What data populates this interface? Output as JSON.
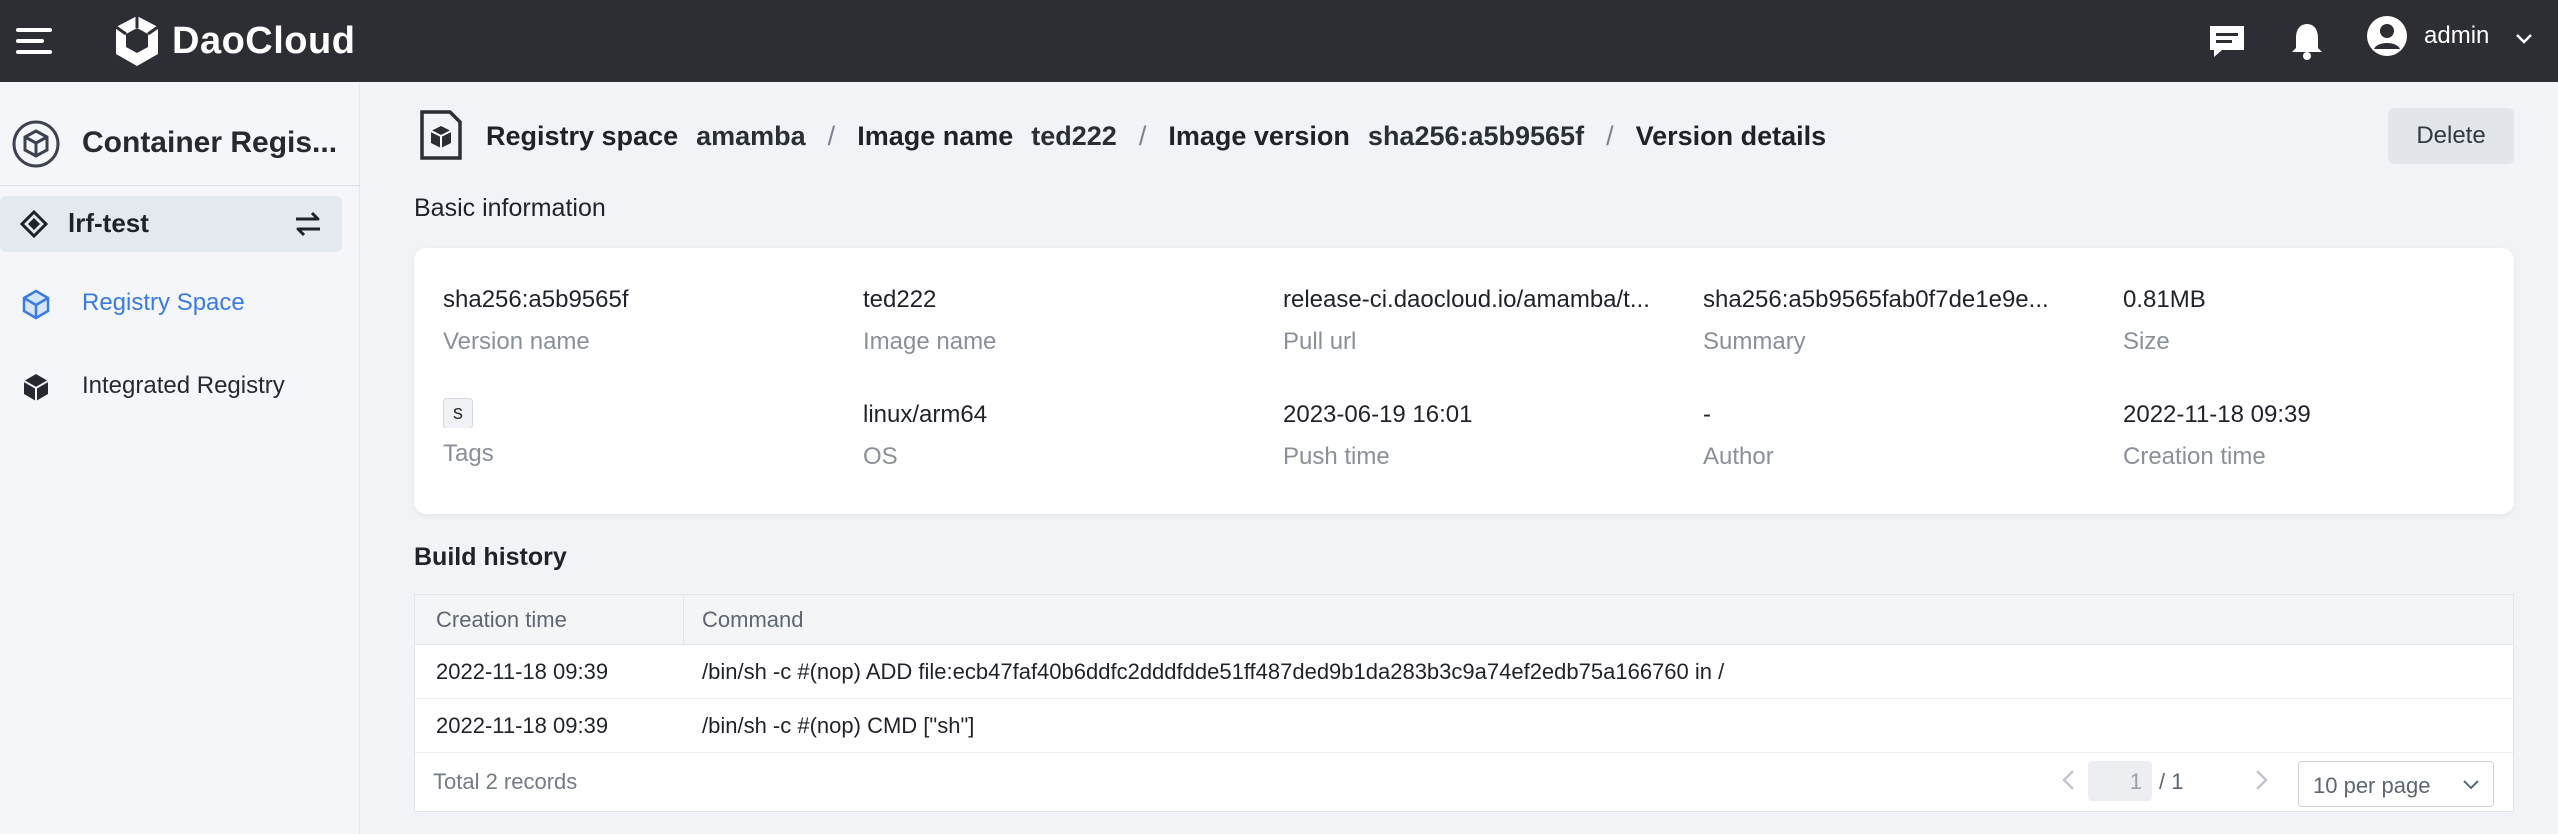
{
  "header": {
    "brand": "DaoCloud",
    "username": "admin"
  },
  "sidebar": {
    "title": "Container Regis...",
    "workspace": "lrf-test",
    "items": [
      {
        "label": "Registry Space",
        "active": true
      },
      {
        "label": "Integrated Registry",
        "active": false
      }
    ]
  },
  "breadcrumb": {
    "space_key": "Registry space",
    "space_value": "amamba",
    "image_key": "Image name",
    "image_value": "ted222",
    "version_key": "Image version",
    "version_value": "sha256:a5b9565f",
    "current": "Version details",
    "separator": "/"
  },
  "actions": {
    "delete_label": "Delete"
  },
  "basic_info": {
    "title": "Basic information",
    "version_name": {
      "value": "sha256:a5b9565f",
      "label": "Version name"
    },
    "image_name": {
      "value": "ted222",
      "label": "Image name"
    },
    "pull_url": {
      "value": "release-ci.daocloud.io/amamba/t...",
      "label": "Pull url"
    },
    "summary": {
      "value": "sha256:a5b9565fab0f7de1e9e...",
      "label": "Summary"
    },
    "size": {
      "value": "0.81MB",
      "label": "Size"
    },
    "tags": {
      "value": "s",
      "label": "Tags"
    },
    "os": {
      "value": "linux/arm64",
      "label": "OS"
    },
    "push_time": {
      "value": "2023-06-19 16:01",
      "label": "Push time"
    },
    "author": {
      "value": "-",
      "label": "Author"
    },
    "creation_time": {
      "value": "2022-11-18 09:39",
      "label": "Creation time"
    }
  },
  "build_history": {
    "title": "Build history",
    "columns": [
      "Creation time",
      "Command"
    ],
    "rows": [
      {
        "time": "2022-11-18 09:39",
        "command": "/bin/sh -c #(nop) ADD file:ecb47faf40b6ddfc2dddfdde51ff487ded9b1da283b3c9a74ef2edb75a166760 in /"
      },
      {
        "time": "2022-11-18 09:39",
        "command": "/bin/sh -c #(nop) CMD [\"sh\"]"
      }
    ],
    "total": "Total 2 records",
    "page_current": "1",
    "page_total": "/ 1",
    "page_size": "10 per page"
  },
  "colors": {
    "topbar": "#2c2e33",
    "accent": "#3a7be0",
    "sidebar_bg": "#f4f6f9",
    "page_bg": "#f1f3f7"
  },
  "icons": {
    "menu": "hamburger-menu-icon",
    "logo": "daocloud-logo-icon",
    "message": "message-icon",
    "notification": "bell-icon",
    "user": "user-avatar-icon",
    "dropdown": "chevron-down-icon",
    "registry": "container-registry-icon",
    "workspace": "workspace-icon",
    "switch": "switch-arrows-icon",
    "space": "cube-icon",
    "integrated": "cubes-icon",
    "page": "image-package-icon",
    "prev": "chevron-left-icon",
    "next": "chevron-right-icon"
  }
}
